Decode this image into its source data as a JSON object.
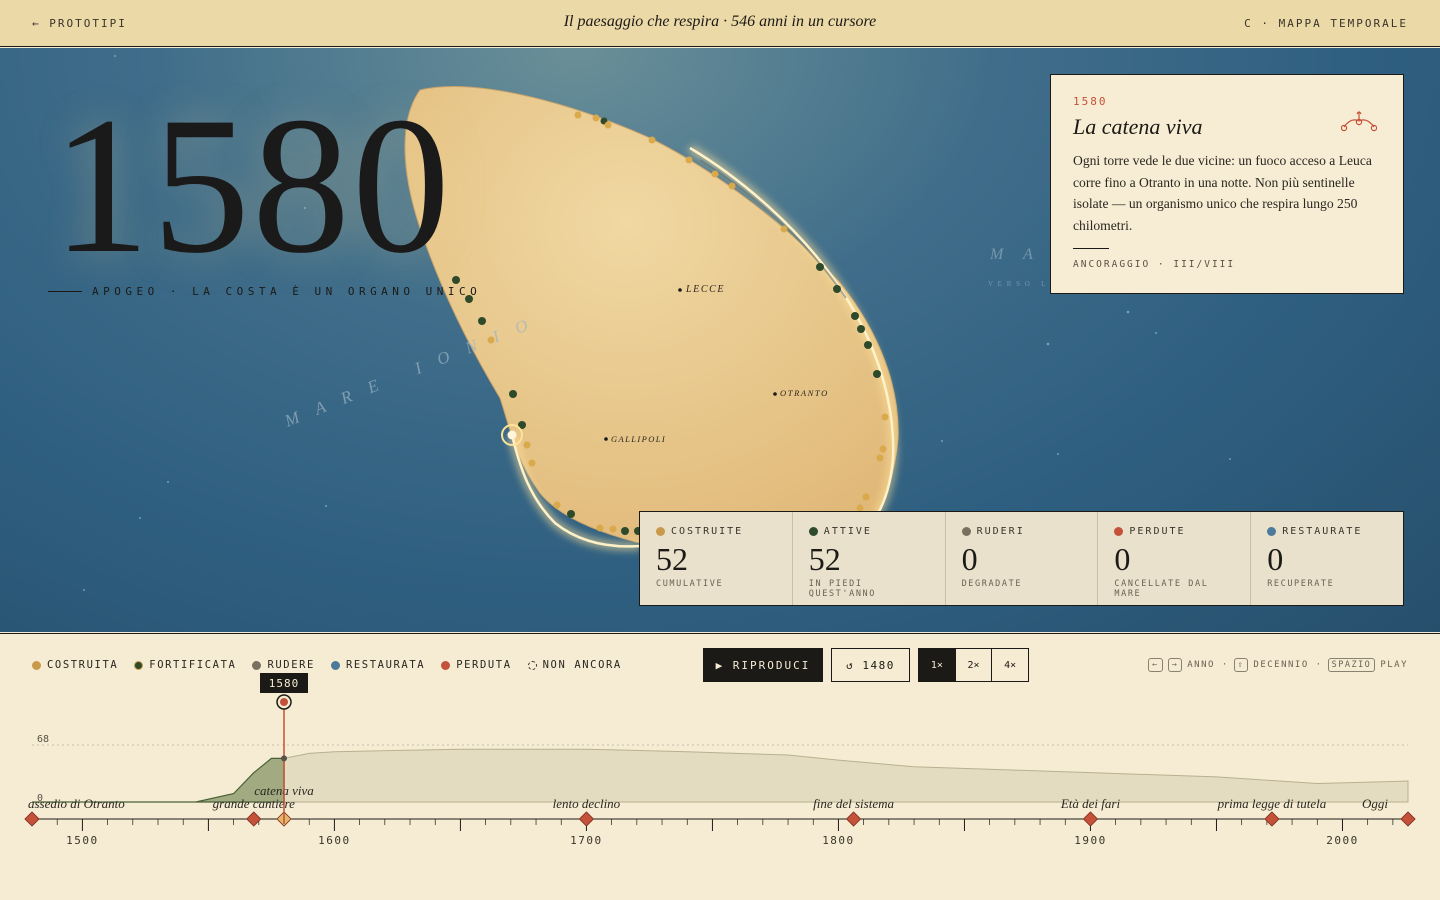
{
  "header": {
    "back_label": "← PROTOTIPI",
    "title": "Il paesaggio che respira · 546 anni in un cursore",
    "nav_label": "C · MAPPA TEMPORALE"
  },
  "map": {
    "year": "1580",
    "era_label": "APOGEO · LA COSTA È UN ORGANO UNICO",
    "sea_labels": [
      "M A R E   I O N I O",
      "M A",
      "V E R S O   L ' A L"
    ],
    "towns": [
      "LECCE",
      "OTRANTO",
      "GALLIPOLI"
    ]
  },
  "card": {
    "year": "1580",
    "title": "La catena viva",
    "body": "Ogni torre vede le due vicine: un fuoco acceso a Leuca corre fino a Otranto in una notte. Non più sentinelle isolate — un organismo unico che respira lungo 250 chilometri.",
    "footer": "ANCORAGGIO · III/VIII",
    "icon": "tower-chain-icon"
  },
  "stats": [
    {
      "label": "COSTRUITE",
      "value": "52",
      "sub": "CUMULATIVE",
      "color": "#c99a4a"
    },
    {
      "label": "ATTIVE",
      "value": "52",
      "sub": "IN PIEDI QUEST'ANNO",
      "color": "#2e4a2a"
    },
    {
      "label": "RUDERI",
      "value": "0",
      "sub": "DEGRADATE",
      "color": "#7a7060"
    },
    {
      "label": "PERDUTE",
      "value": "0",
      "sub": "CANCELLATE DAL MARE",
      "color": "#c4523a"
    },
    {
      "label": "RESTAURATE",
      "value": "0",
      "sub": "RECUPERATE",
      "color": "#4b7a9a"
    }
  ],
  "legend": [
    {
      "label": "COSTRUITA",
      "color": "#c99a4a"
    },
    {
      "label": "FORTIFICATA",
      "color": "#2e4a2a"
    },
    {
      "label": "RUDERE",
      "color": "#7a7060"
    },
    {
      "label": "RESTAURATA",
      "color": "#4b7a9a"
    },
    {
      "label": "PERDUTA",
      "color": "#c4523a"
    },
    {
      "label": "NON ANCORA",
      "color": "none"
    }
  ],
  "controls": {
    "play_label": "▶  RIPRODUCI",
    "reset_label": "↺  1480",
    "speeds": [
      "1×",
      "2×",
      "4×"
    ],
    "active_speed": "1×",
    "shortcuts": {
      "year_keys": [
        "←",
        "→"
      ],
      "year_label": "ANNO ·",
      "decade_key": "⇧",
      "decade_label": "DECENNIO ·",
      "play_key": "SPAZIO",
      "play_label": "PLAY"
    }
  },
  "timeline": {
    "current_year": "1580",
    "y_max_label": "68",
    "y_min_label": "0",
    "start_year": 1480,
    "end_year": 2026,
    "tick_labels": [
      "1500",
      "1600",
      "1700",
      "1800",
      "1900",
      "2000"
    ],
    "events": [
      {
        "year": 1480,
        "label": "assedio di Otranto"
      },
      {
        "year": 1568,
        "label": "grande cantiere"
      },
      {
        "year": 1580,
        "label": "catena viva"
      },
      {
        "year": 1700,
        "label": "lento declino"
      },
      {
        "year": 1806,
        "label": "fine del sistema"
      },
      {
        "year": 1900,
        "label": "Età dei fari"
      },
      {
        "year": 1972,
        "label": "prima legge di tutela"
      },
      {
        "year": 2026,
        "label": "Oggi"
      }
    ]
  },
  "chart_data": {
    "type": "area",
    "xlabel": "",
    "ylabel": "",
    "ylim": [
      0,
      68
    ],
    "x": [
      1480,
      1545,
      1560,
      1568,
      1575,
      1580,
      1590,
      1600,
      1650,
      1700,
      1740,
      1780,
      1800,
      1830,
      1870,
      1900,
      1950,
      1990,
      2026
    ],
    "series": [
      {
        "values": [
          0,
          0,
          10,
          35,
          52,
          52,
          58,
          60,
          63,
          63,
          60,
          56,
          50,
          42,
          38,
          35,
          30,
          22,
          25
        ]
      }
    ]
  }
}
